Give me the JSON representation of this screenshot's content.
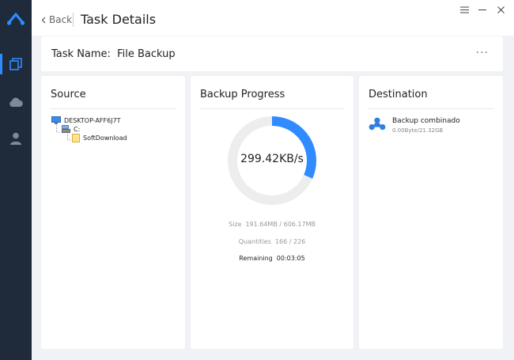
{
  "header": {
    "back_label": "Back",
    "title": "Task Details"
  },
  "task": {
    "label": "Task Name:",
    "name": "File Backup",
    "more_label": "···"
  },
  "source": {
    "title": "Source",
    "tree": [
      {
        "label": "DESKTOP-AFF6J7T",
        "icon": "computer-icon"
      },
      {
        "label": "C:",
        "icon": "drive-icon"
      },
      {
        "label": "SoftDownload",
        "icon": "folder-icon"
      }
    ]
  },
  "progress": {
    "title": "Backup Progress",
    "speed": "299.42KB/s",
    "fraction": 0.316,
    "size_label": "Size",
    "size_value": "191.64MB / 606.17MB",
    "quantities_label": "Quantities",
    "quantities_value": "166 / 226",
    "remaining_label": "Remaining",
    "remaining_value": "00:03:05"
  },
  "destination": {
    "title": "Destination",
    "name": "Backup combinado",
    "size": "0.00Byte/21.32GB",
    "icon": "cloud-share-icon"
  },
  "colors": {
    "sidebar": "#1f2a3a",
    "accent": "#2f8bff",
    "background": "#f0f2f5"
  }
}
